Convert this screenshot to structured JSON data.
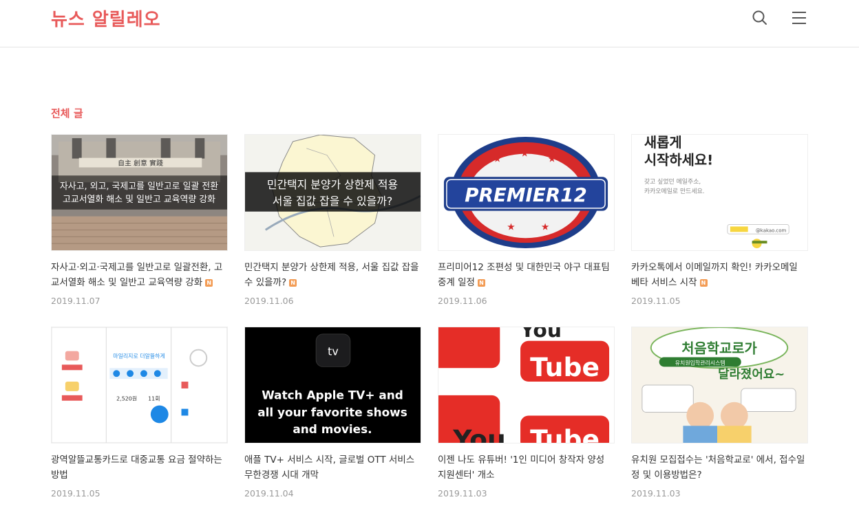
{
  "header": {
    "logo": "뉴스 알릴레오"
  },
  "section": {
    "title": "전체 글"
  },
  "badge_new": "N",
  "posts": [
    {
      "title": "자사고·외고·국제고를 일반고로 일괄전환, 고교서열화 해소 및 일반고 교육역량 강화",
      "date": "2019.11.07",
      "is_new": true,
      "thumb_caption_1": "자사고, 외고, 국제고를 일반고로 일괄 전환",
      "thumb_caption_2": "고교서열화 해소 및 일반고 교육역량 강화",
      "thumb_sign": "自主 創意 實踐"
    },
    {
      "title": "민간택지 분양가 상한제 적용, 서울 집값 잡을 수 있을까?",
      "date": "2019.11.06",
      "is_new": true,
      "thumb_caption_1": "민간택지 분양가 상한제 적용",
      "thumb_caption_2": "서울 집값 잡을 수 있을까?"
    },
    {
      "title": "프리미어12 조편성 및 대한민국 야구 대표팀 중계 일정",
      "date": "2019.11.06",
      "is_new": true,
      "thumb_caption_1": "PREMIER12"
    },
    {
      "title": "카카오톡에서 이메일까지 확인! 카카오메일 베타 서비스 시작",
      "date": "2019.11.05",
      "is_new": true,
      "thumb_caption_1": "새롭게",
      "thumb_caption_2": "시작하세요!",
      "thumb_caption_3": "갖고 싶었던 메일주소,",
      "thumb_caption_4": "카카오메일로 만드세요.",
      "thumb_caption_5": "@kakao.com"
    },
    {
      "title": "광역알뜰교통카드로 대중교통 요금 절약하는 방법",
      "date": "2019.11.05",
      "is_new": false,
      "thumb_caption_1": "2,520원",
      "thumb_caption_2": "11회",
      "thumb_caption_3": "마일리지로 더알뜰하게"
    },
    {
      "title": "애플 TV+ 서비스 시작, 글로벌 OTT 서비스 무한경쟁 시대 개막",
      "date": "2019.11.04",
      "is_new": false,
      "thumb_caption_1": "tv",
      "thumb_caption_2": "Watch Apple TV+ and",
      "thumb_caption_3": "all your favorite shows",
      "thumb_caption_4": "and movies."
    },
    {
      "title": "이젠 나도 유튜버! '1인 미디어 창작자 양성 지원센터' 개소",
      "date": "2019.11.03",
      "is_new": false,
      "thumb_caption_1": "You",
      "thumb_caption_2": "Tube"
    },
    {
      "title": "유치원 모집접수는 '처음학교로' 에서, 접수일정 및 이용방법은?",
      "date": "2019.11.03",
      "is_new": false,
      "thumb_caption_1": "처음학교로가",
      "thumb_caption_2": "달라졌어요~",
      "thumb_caption_3": "유치원입학관리시스템"
    }
  ],
  "colors": {
    "accent": "#e85a5a",
    "new_badge": "#f39c55",
    "date": "#999999"
  }
}
